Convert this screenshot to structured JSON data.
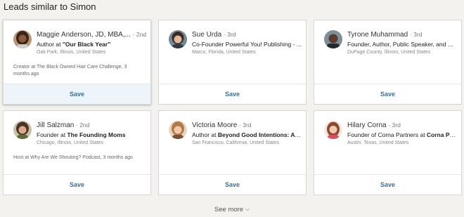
{
  "section": {
    "title": "Leads similar to Simon"
  },
  "leads": [
    {
      "name": "Maggie Anderson, JD, MBA,...",
      "degree": "· 2nd",
      "headline_prefix": "Author at ",
      "headline_org": "\"Our Black Year\"",
      "location": "Oak Park, Illinois, United States",
      "extra": "Creator at The Black Owned Hair Care Challenge, 3 months ago",
      "save_label": "Save"
    },
    {
      "name": "Sue Urda",
      "degree": "· 3rd",
      "headline_prefix": "Co-Founder Powerful You! Publishing - ...",
      "headline_org": "",
      "location": "Marco, Florida, United States",
      "extra": "",
      "save_label": "Save"
    },
    {
      "name": "Tyrone Muhammad",
      "degree": "· 3rd",
      "headline_prefix": "Founder, Author, Public Speaker, and M...",
      "headline_org": "",
      "location": "DuPage County, Illinois, United States",
      "extra": "",
      "save_label": "Save"
    },
    {
      "name": "Jill Salzman",
      "degree": "· 2nd",
      "headline_prefix": "Founder at ",
      "headline_org": "The Founding Moms",
      "location": "Chicago, Illinois, United States",
      "extra": "Host at Why Are We Shouting? Podcast, 3 months ago",
      "save_label": "Save"
    },
    {
      "name": "Victoria Moore",
      "degree": "· 3rd",
      "headline_prefix": "Author at ",
      "headline_org": "Beyond Good Intentions: A J...",
      "location": "San Francisco, California, United States",
      "extra": "",
      "save_label": "Save"
    },
    {
      "name": "Hilary Corna",
      "degree": "· 3rd",
      "headline_prefix": "Founder of Corna Partners at ",
      "headline_org": "Corna Par...",
      "location": "Austin, Texas, United States",
      "extra": "",
      "save_label": "Save"
    }
  ],
  "see_more": {
    "label": "See more",
    "icon": "chevron-down-icon"
  },
  "colors": {
    "accent": "#3b6f94",
    "background": "#f3f2ef"
  }
}
